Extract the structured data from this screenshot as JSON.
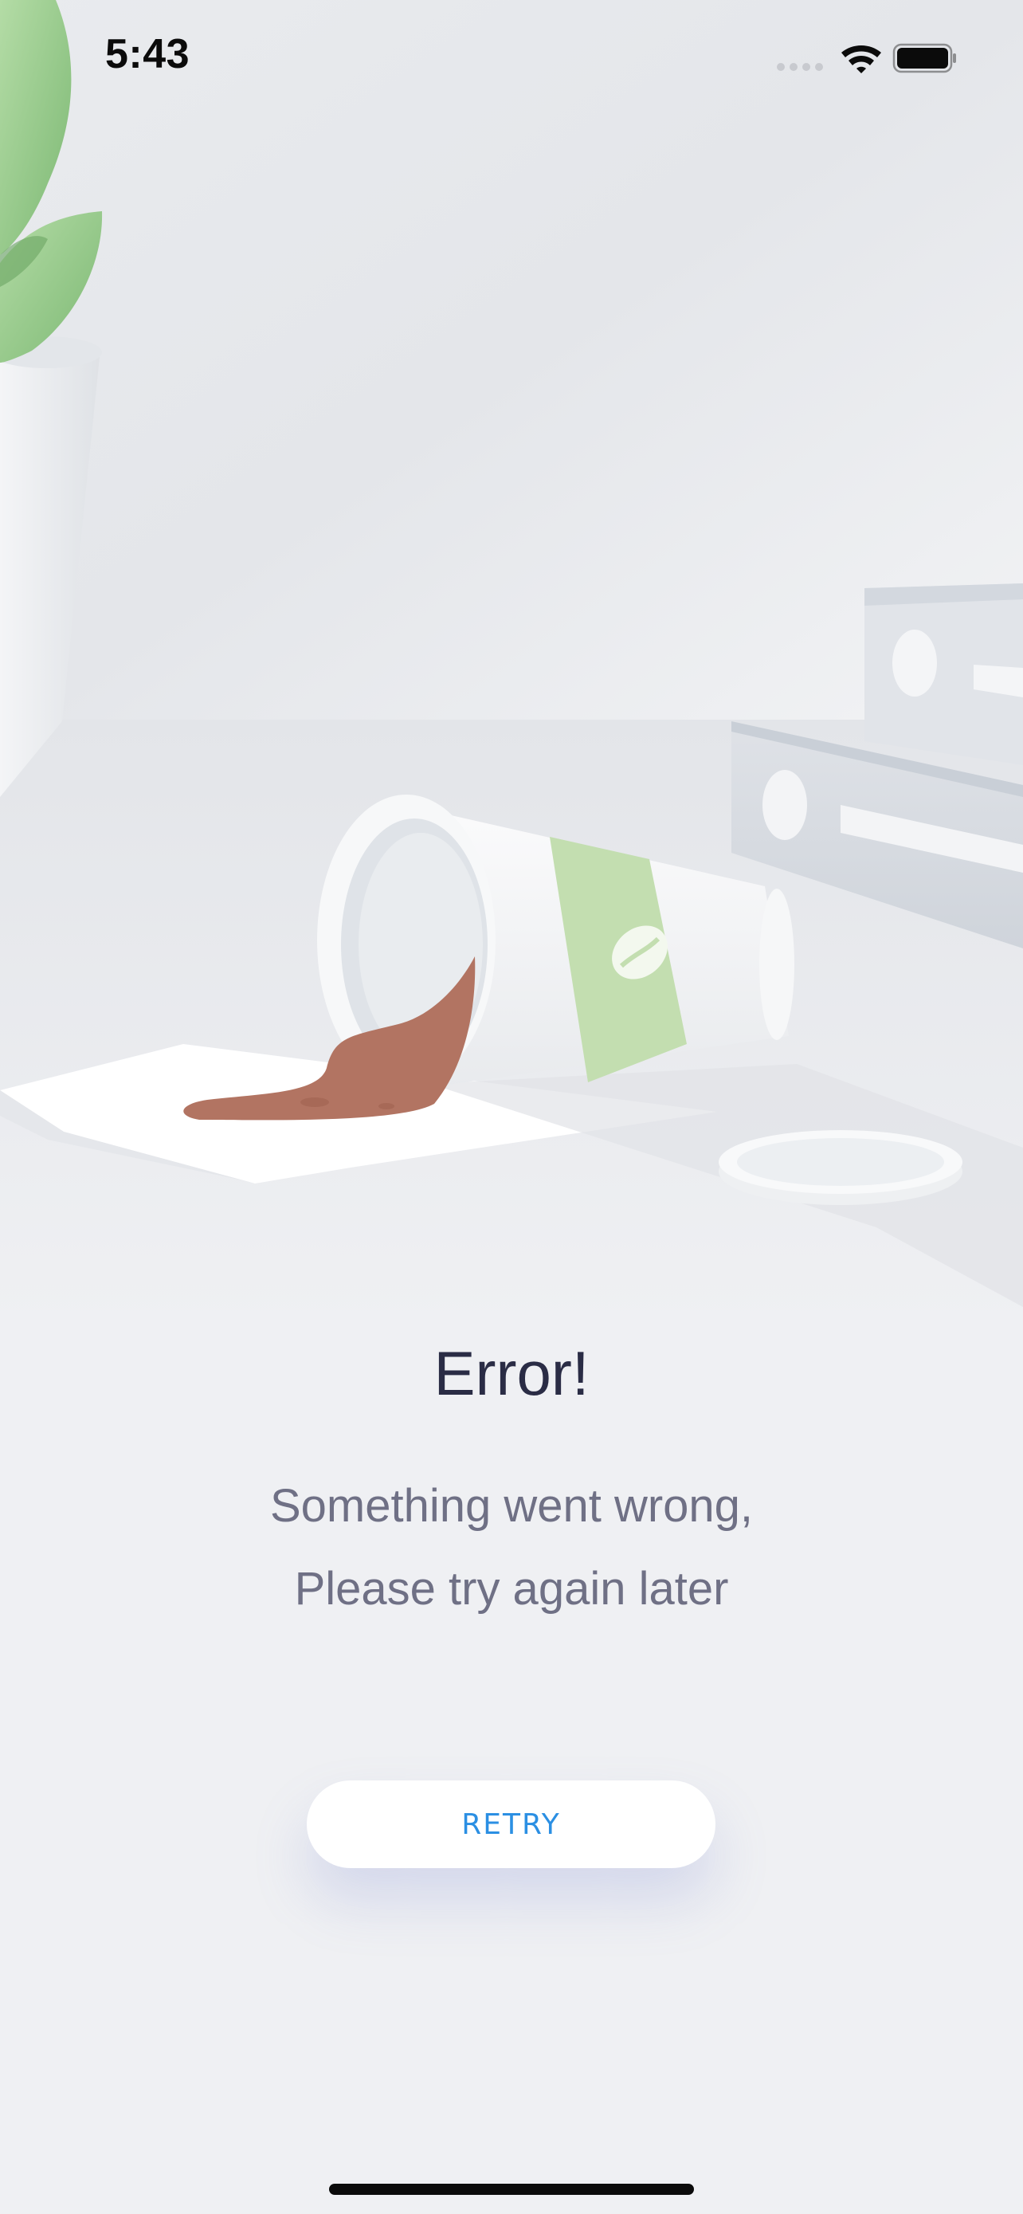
{
  "status_bar": {
    "time": "5:43",
    "icons": [
      "signal-icon",
      "wifi-icon",
      "battery-icon"
    ]
  },
  "illustration": {
    "description_icon": "spilled-coffee-illustration",
    "colors": {
      "background": "#eff0f3",
      "wall": "#e6e8ec",
      "cup_band": "#c3deb0",
      "coffee": "#b27462",
      "leaf": "#8fc587"
    }
  },
  "error": {
    "title": "Error!",
    "message_line1": "Something went wrong,",
    "message_line2": "Please try again later"
  },
  "actions": {
    "retry_label": "RETRY",
    "retry_color": "#2b8fe3"
  }
}
